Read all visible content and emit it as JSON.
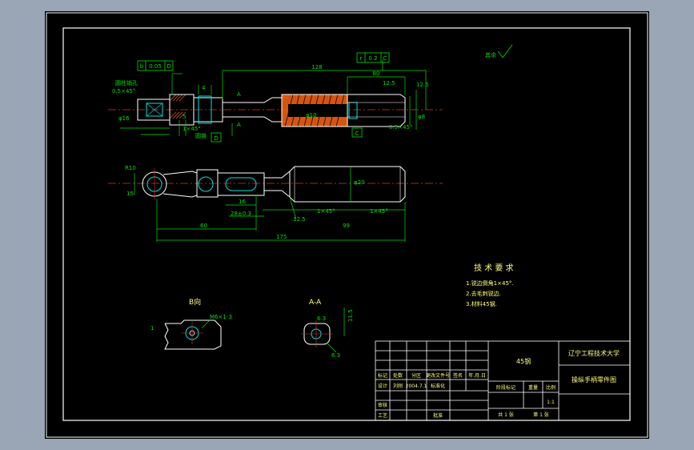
{
  "colors": {
    "viewport_bg": "#9aa6b6",
    "paper": "#000000",
    "border": "#ffffff",
    "geometry": "#ffffff",
    "dimension": "#00e000",
    "hatch": "#e05a10",
    "centerline": "#e03030",
    "highlight": "#00e0e0",
    "text_yellow": "#ffff80"
  },
  "front_view": {
    "overall_dim": "128",
    "right_dim": "80",
    "tol_left": [
      "b",
      "0.05",
      "D"
    ],
    "tol_right": [
      "r",
      "0.2",
      "C"
    ],
    "hole_note_title": "圆柱销孔",
    "hole_note_size": "0.5×45°",
    "dim_1": "12.5",
    "dim_2": "4",
    "dim_3": "12.5",
    "dim_4": "5",
    "datum_d": "D",
    "datum_c": "C",
    "chamfer_left": "1×45°",
    "chamfer_right": "0.5×45°",
    "dia_mid": "φ10",
    "dia_left": "φ16",
    "dia_right": "φ8",
    "cut_mark_top": "A",
    "cut_mark_bottom": "A",
    "label_small": "圆锥",
    "roughness_note": "其余"
  },
  "top_view": {
    "radius_dim": "R10",
    "dim_15": "15",
    "dim_16": "16",
    "dim_28": "28±0.3",
    "dim_60": "60",
    "dim_99": "99",
    "overall_dim": "175",
    "chamfer_a": "1×45°",
    "chamfer_b": "1×45°",
    "dia_right": "φ20",
    "angle_note": "12.5"
  },
  "view_b": {
    "title": "B向",
    "note": "M6×1-3",
    "dim": "1"
  },
  "view_aa": {
    "title": "A-A",
    "dim_top": "6.3",
    "dim_side": "11.5",
    "dim_bottom": "6.3"
  },
  "tech_req": {
    "title": "技 术 要 求",
    "items": [
      "1.锐边倒角1×45°.",
      "2.去毛刺锐边.",
      "3.材料45钢."
    ]
  },
  "title_block": {
    "material": "45钢",
    "school": "辽宁工程技术大学",
    "drawing_name": "操纵手柄零件图",
    "header_cells": [
      "标记",
      "处数",
      "分区",
      "更改文件号",
      "签名",
      "年.月.日"
    ],
    "design_row": [
      "设计",
      "刘刚",
      "2004.7.1",
      "标准化"
    ],
    "stage_label": "阶段标记",
    "weight_label": "重量",
    "scale_label": "比例",
    "scale_value": "1:1",
    "review_label": "审核",
    "process_label": "工艺",
    "approve_label": "批准",
    "sheet_total": "共  1  张",
    "sheet_no": "第  1  张"
  }
}
